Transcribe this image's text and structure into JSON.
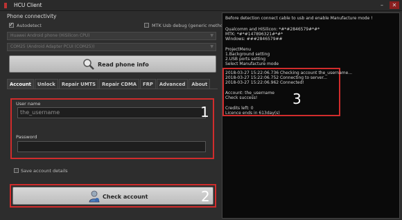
{
  "window": {
    "title": "HCU Client"
  },
  "phone_connectivity": {
    "section_label": "Phone connectivity",
    "autodetect_label": "Autodetect",
    "autodetect_checked": true,
    "mtk_debug_label": "MTK Usb debug (generic method)",
    "mtk_debug_checked": false,
    "device_combo_value": "Huawei Android phone (HiSilicon CPU)",
    "port_combo_value": "COM25 (Android Adapter PCUI (COM25))",
    "read_button_label": "Read phone info"
  },
  "tabs": [
    {
      "label": "Account",
      "active": true
    },
    {
      "label": "Unlock",
      "active": false
    },
    {
      "label": "Repair UMTS",
      "active": false
    },
    {
      "label": "Repair CDMA",
      "active": false
    },
    {
      "label": "FRP",
      "active": false
    },
    {
      "label": "Advanced",
      "active": false
    },
    {
      "label": "About",
      "active": false
    }
  ],
  "account": {
    "username_label": "User name",
    "username_value": "the_username",
    "password_label": "Password",
    "password_value": "",
    "save_details_label": "Save account details",
    "save_details_checked": false,
    "check_button_label": "Check account"
  },
  "annotations": {
    "box1": "1",
    "box2": "2",
    "box3": "3"
  },
  "console": {
    "lines": [
      "Before detection connect cable to usb and enable Manufacture mode !",
      "",
      "Qualcomm and HiSilicon: *#*#2846579#*#*",
      "MTK: *#*#147896321#*#*",
      "Windows: ###2846579##",
      "",
      "ProjectMenu",
      "1.Background setting",
      "2.USB ports setting",
      "Select Manufacture mode",
      "",
      "2018-03-27 15:22:06.736 Checking account the_username...",
      "2018-03-27 15:22:06.752 Connecting to server...",
      "2018-03-27 15:22:06.962 Connected!",
      "",
      "Account: the_username",
      "Check success!",
      "",
      "Credits left: 0",
      "Licence ends in 613day(s)"
    ]
  },
  "colors": {
    "annotation_red": "#d12c2c",
    "console_bg": "#0a0a0a",
    "panel_bg": "#2d2d2d"
  }
}
